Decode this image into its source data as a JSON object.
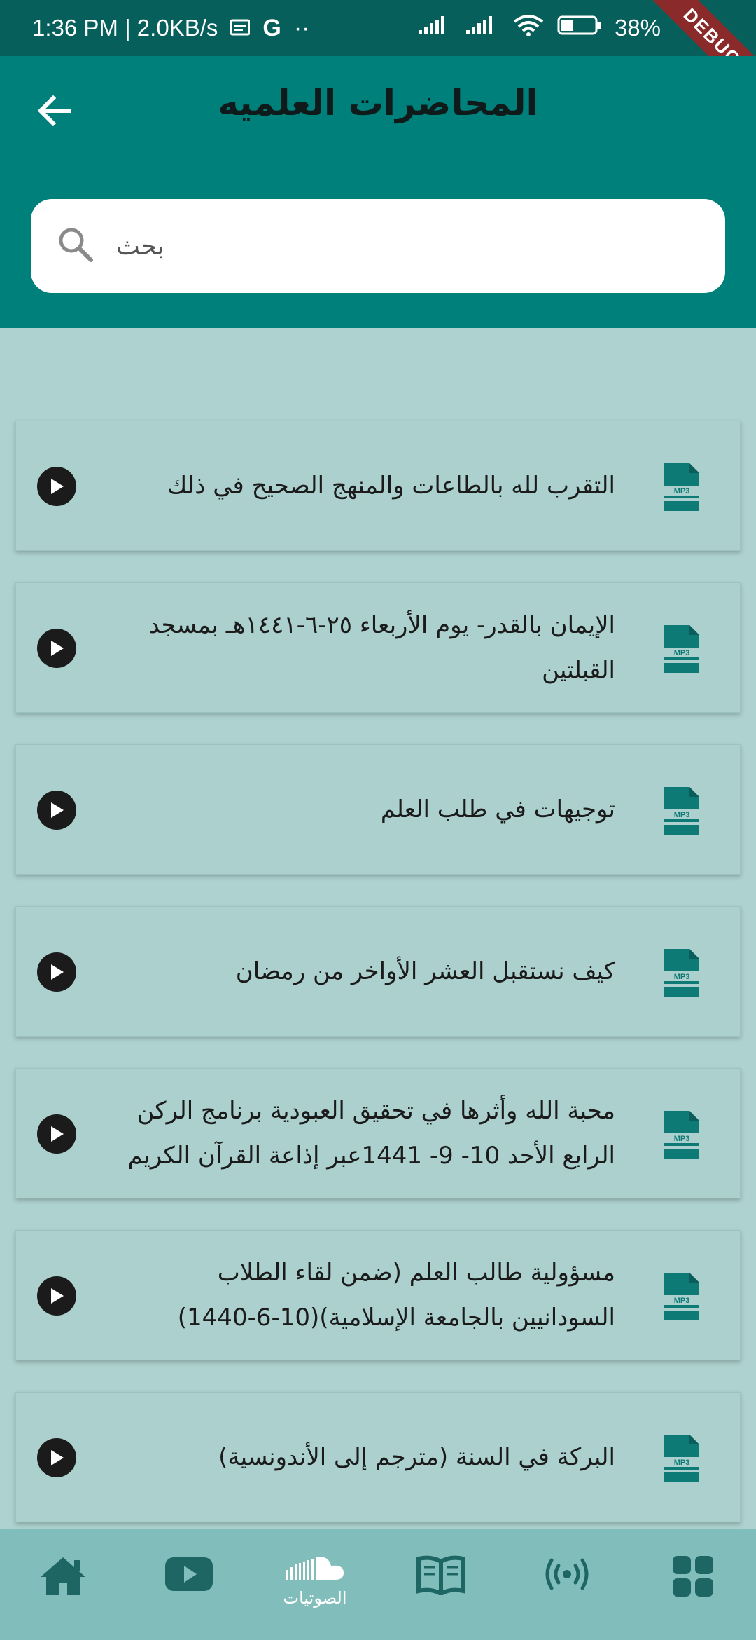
{
  "status_bar": {
    "time_speed": "1:36 PM | 2.0KB/s",
    "g_label": "G",
    "dots": "··",
    "battery": "38%",
    "debug": "DEBUG"
  },
  "header": {
    "title": "المحاضرات العلميه"
  },
  "search": {
    "placeholder": "بحث"
  },
  "lectures": [
    {
      "title": "التقرب لله بالطاعات والمنهج الصحيح في ذلك"
    },
    {
      "title": "الإيمان بالقدر- يوم الأربعاء ٢٥-٦-١٤٤١هـ بمسجد القبلتين"
    },
    {
      "title": "توجيهات في طلب العلم"
    },
    {
      "title": "كيف نستقبل العشر الأواخر من رمضان"
    },
    {
      "title": "محبة الله وأثرها في تحقيق العبودية برنامج الركن الرابع الأحد 10- 9-  1441عبر إذاعة القرآن الكريم"
    },
    {
      "title": "مسؤولية طالب العلم  (ضمن لقاء الطلاب السودانيين بالجامعة الإسلامية)(10-6-1440)"
    },
    {
      "title": "البركة في السنة (مترجم إلى الأندونسية)"
    }
  ],
  "file_icon_label": "MP3",
  "bottom_nav": {
    "active_label": "الصوتيات"
  },
  "colors": {
    "primary": "#00807b",
    "status_bar": "#075f5b",
    "background": "#add2d0",
    "nav_background": "#80bdbb",
    "icon_teal": "#0e7a76",
    "nav_icon": "#1e6664"
  }
}
